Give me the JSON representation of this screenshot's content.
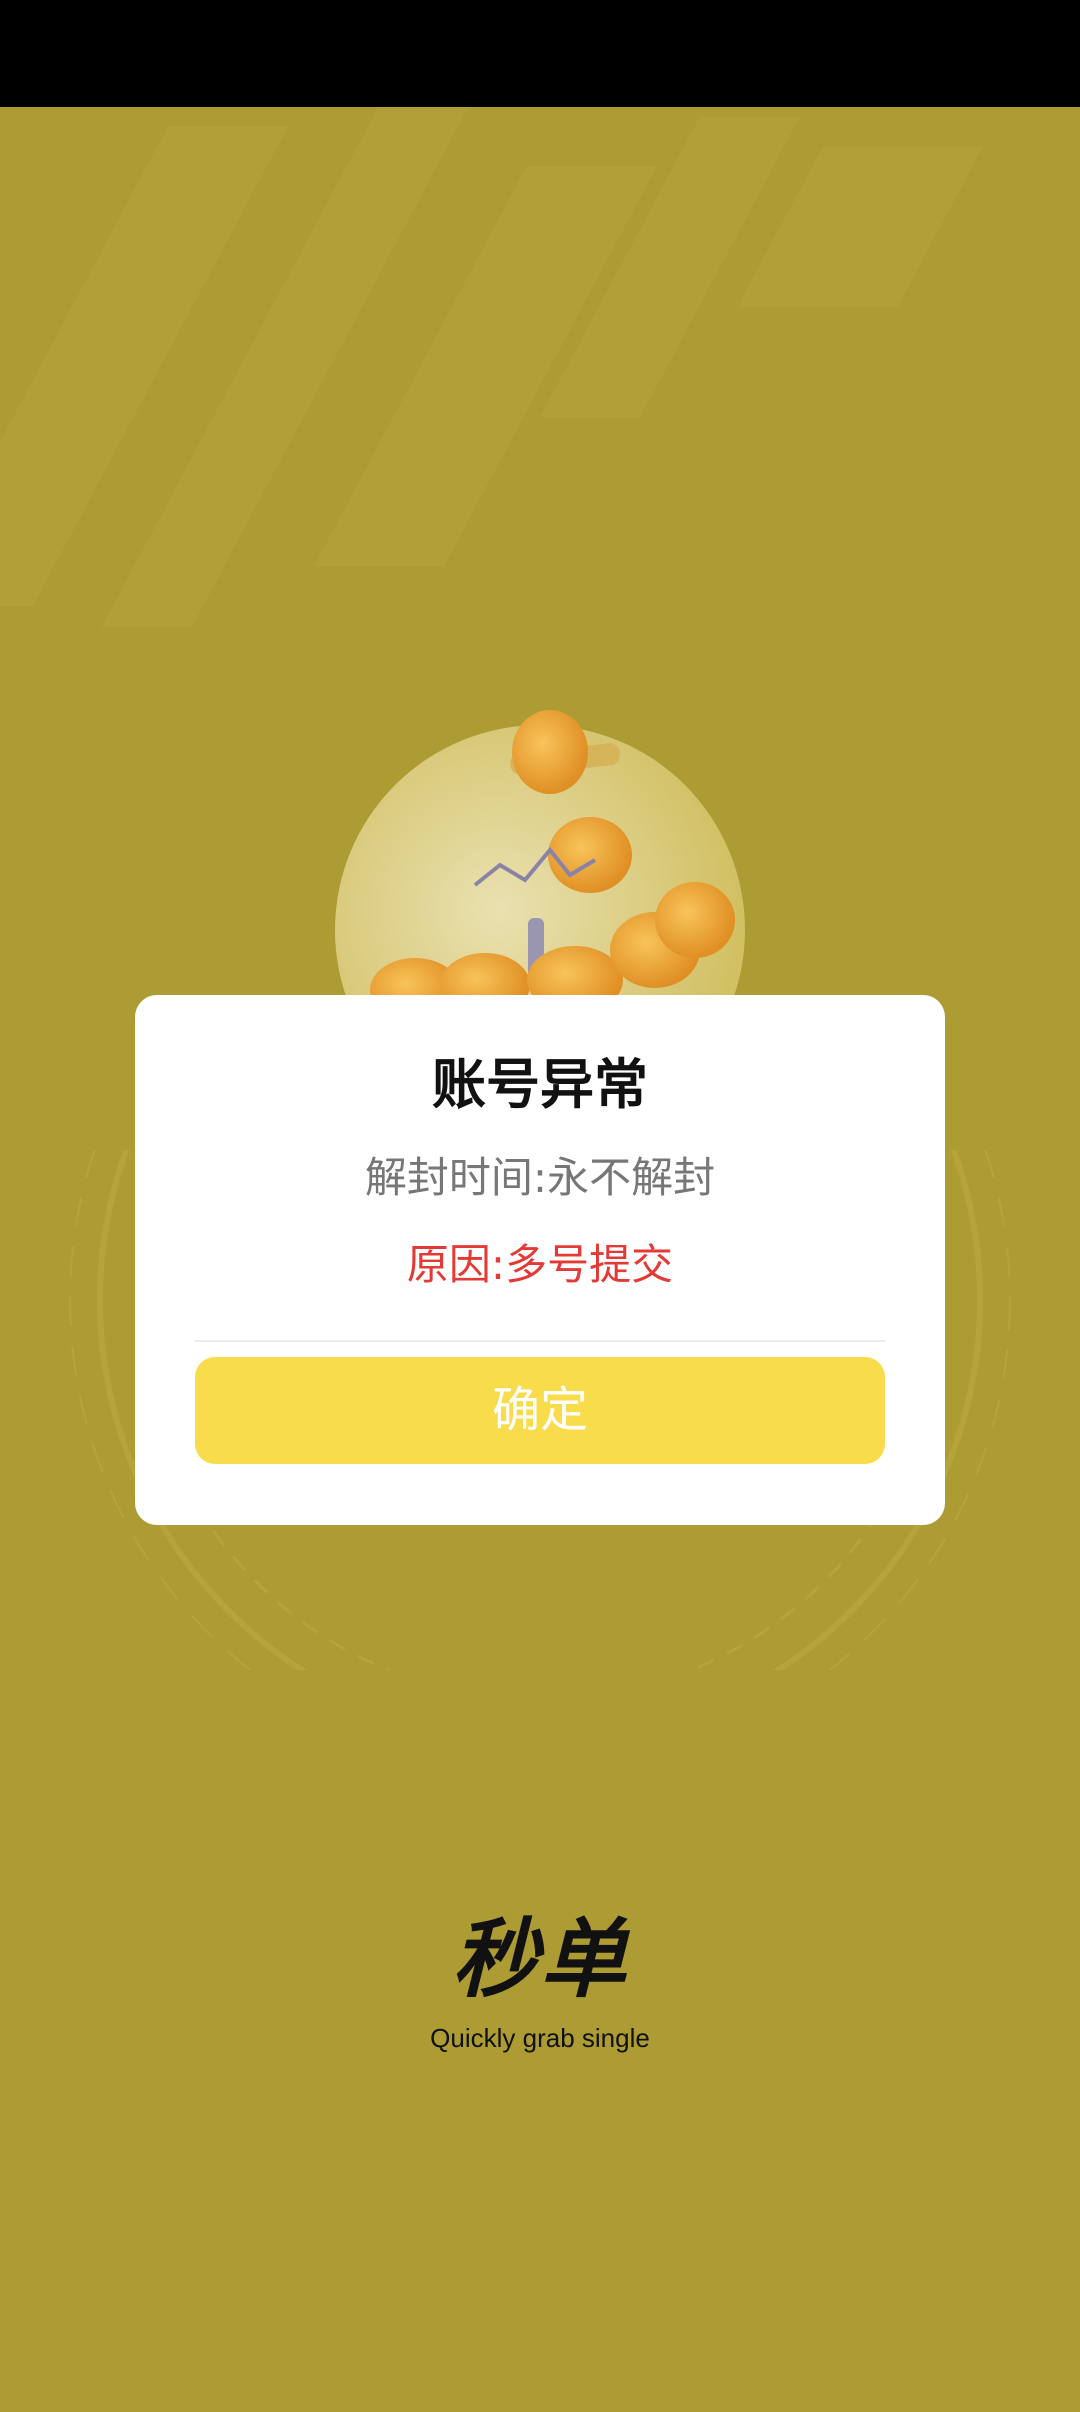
{
  "dialog": {
    "title": "账号异常",
    "unban_time": "解封时间:永不解封",
    "reason": "原因:多号提交",
    "confirm_label": "确定"
  },
  "brand": {
    "logo_text": "秒单",
    "tagline": "Quickly grab single"
  },
  "colors": {
    "background": "#ad9b34",
    "dialog_bg": "#ffffff",
    "button_bg": "#f9dc4c",
    "reason_red": "#e53935",
    "status_bar": "#000000"
  },
  "icons": [
    "coin-jar-illustration"
  ]
}
